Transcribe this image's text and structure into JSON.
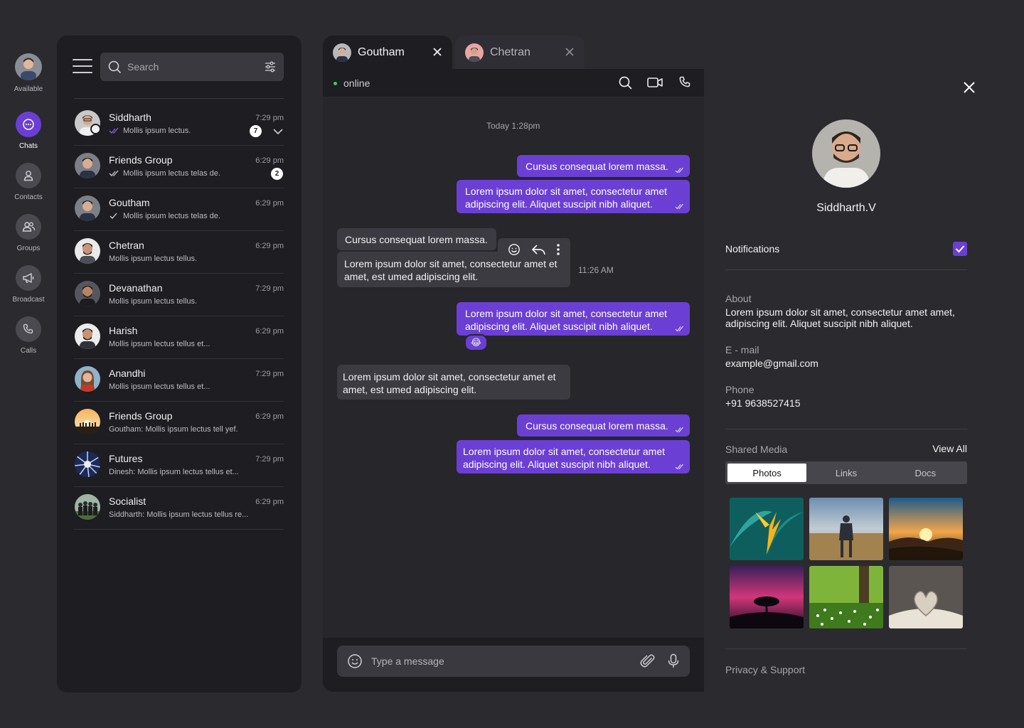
{
  "rail": {
    "items": [
      {
        "label": "Available"
      },
      {
        "label": "Chats"
      },
      {
        "label": "Contacts"
      },
      {
        "label": "Groups"
      },
      {
        "label": "Broadcast"
      },
      {
        "label": "Calls"
      }
    ]
  },
  "search": {
    "placeholder": "Search"
  },
  "chats": [
    {
      "name": "Siddharth",
      "preview": "Mollis ipsum lectus.",
      "time": "7:29 pm",
      "badge": "7"
    },
    {
      "name": "Friends Group",
      "preview": "Mollis ipsum lectus telas de.",
      "time": "6:29 pm",
      "badge": "2"
    },
    {
      "name": "Goutham",
      "preview": "Mollis ipsum lectus telas de.",
      "time": "6:29 pm"
    },
    {
      "name": "Chetran",
      "preview": "Mollis ipsum lectus tellus.",
      "time": "6:29 pm"
    },
    {
      "name": "Devanathan",
      "preview": "Mollis ipsum lectus tellus.",
      "time": "7:29 pm"
    },
    {
      "name": "Harish",
      "preview": "Mollis ipsum lectus tellus et...",
      "time": "6:29 pm"
    },
    {
      "name": "Anandhi",
      "preview": "Mollis ipsum lectus tellus et...",
      "time": "7:29 pm"
    },
    {
      "name": "Friends Group",
      "preview": "Goutham: Mollis ipsum lectus tell yef.",
      "time": "6:29 pm"
    },
    {
      "name": "Futures",
      "preview": "Dinesh: Mollis ipsum lectus tellus et...",
      "time": "7:29 pm"
    },
    {
      "name": "Socialist",
      "preview": "Siddharth: Mollis ipsum lectus tellus re...",
      "time": "6:29 pm"
    }
  ],
  "tabs": [
    {
      "name": "Goutham"
    },
    {
      "name": "Chetran"
    }
  ],
  "conversation": {
    "status": "online",
    "day_stamp": "Today 1:28pm",
    "messages": [
      {
        "text": "Cursus consequat lorem massa."
      },
      {
        "text": "Lorem ipsum dolor sit amet, consectetur amet adipiscing elit. Aliquet suscipit nibh aliquet."
      },
      {
        "text": "Cursus consequat lorem massa."
      },
      {
        "text": "Lorem ipsum dolor sit amet, consectetur amet et amet, est umed adipiscing elit."
      },
      {
        "text": "Lorem ipsum dolor sit amet, consectetur amet adipiscing elit. Aliquet suscipit nibh aliquet."
      },
      {
        "text": "Lorem ipsum dolor sit amet, consectetur amet et amet, est umed adipiscing elit."
      },
      {
        "text": "Cursus consequat lorem massa."
      },
      {
        "text": "Lorem ipsum dolor sit amet, consectetur amet adipiscing elit. Aliquet suscipit nibh aliquet."
      }
    ],
    "message_time": "11:26 AM",
    "reaction_emoji": "😂",
    "composer_placeholder": "Type a message"
  },
  "profile": {
    "name": "Siddharth.V",
    "notifications_label": "Notifications",
    "about_label": "About",
    "about_value": "Lorem ipsum dolor sit amet, consectetur amet amet, adipiscing elit. Aliquet suscipit nibh aliquet.",
    "email_label": "E - mail",
    "email_value": "example@gmail.com",
    "phone_label": "Phone",
    "phone_value": "+91 9638527415",
    "shared_media_label": "Shared Media",
    "view_all": "View All",
    "media_tabs": [
      "Photos",
      "Links",
      "Docs"
    ],
    "privacy_label": "Privacy & Support"
  },
  "colors": {
    "accent": "#6b3fd3",
    "online": "#2fd45a",
    "panel": "#1e1d22",
    "background": "#2b2a2f"
  }
}
